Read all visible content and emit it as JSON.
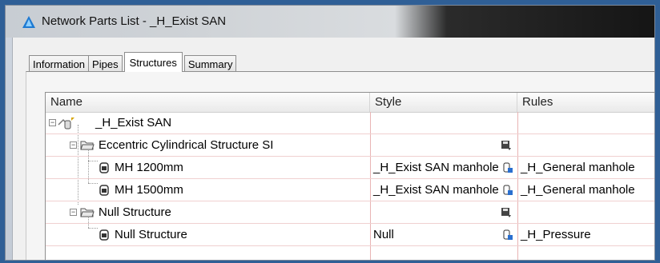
{
  "window": {
    "title": "Network Parts List - _H_Exist SAN"
  },
  "tabs": [
    {
      "label": "Information",
      "active": false
    },
    {
      "label": "Pipes",
      "active": false
    },
    {
      "label": "Structures",
      "active": true
    },
    {
      "label": "Summary",
      "active": false
    }
  ],
  "grid": {
    "columns": [
      "Name",
      "Style",
      "Rules"
    ],
    "rows": [
      {
        "name": "_H_Exist SAN",
        "style": "",
        "rules": ""
      },
      {
        "name": "Eccentric Cylindrical Structure SI",
        "style": "",
        "rules": ""
      },
      {
        "name": "MH 1200mm",
        "style": "_H_Exist SAN manhole",
        "rules": "_H_General manhole"
      },
      {
        "name": "MH 1500mm",
        "style": "_H_Exist SAN manhole",
        "rules": "_H_General manhole"
      },
      {
        "name": "Null Structure",
        "style": "",
        "rules": ""
      },
      {
        "name": "Null Structure",
        "style": "Null",
        "rules": "_H_Pressure"
      }
    ]
  },
  "colors": {
    "background": "#2f5f96",
    "grid_line": "#e8b4b4"
  },
  "icons": [
    "app-icon",
    "network-icon",
    "folder-icon",
    "structure-icon",
    "save-icon",
    "edit-style-icon"
  ]
}
